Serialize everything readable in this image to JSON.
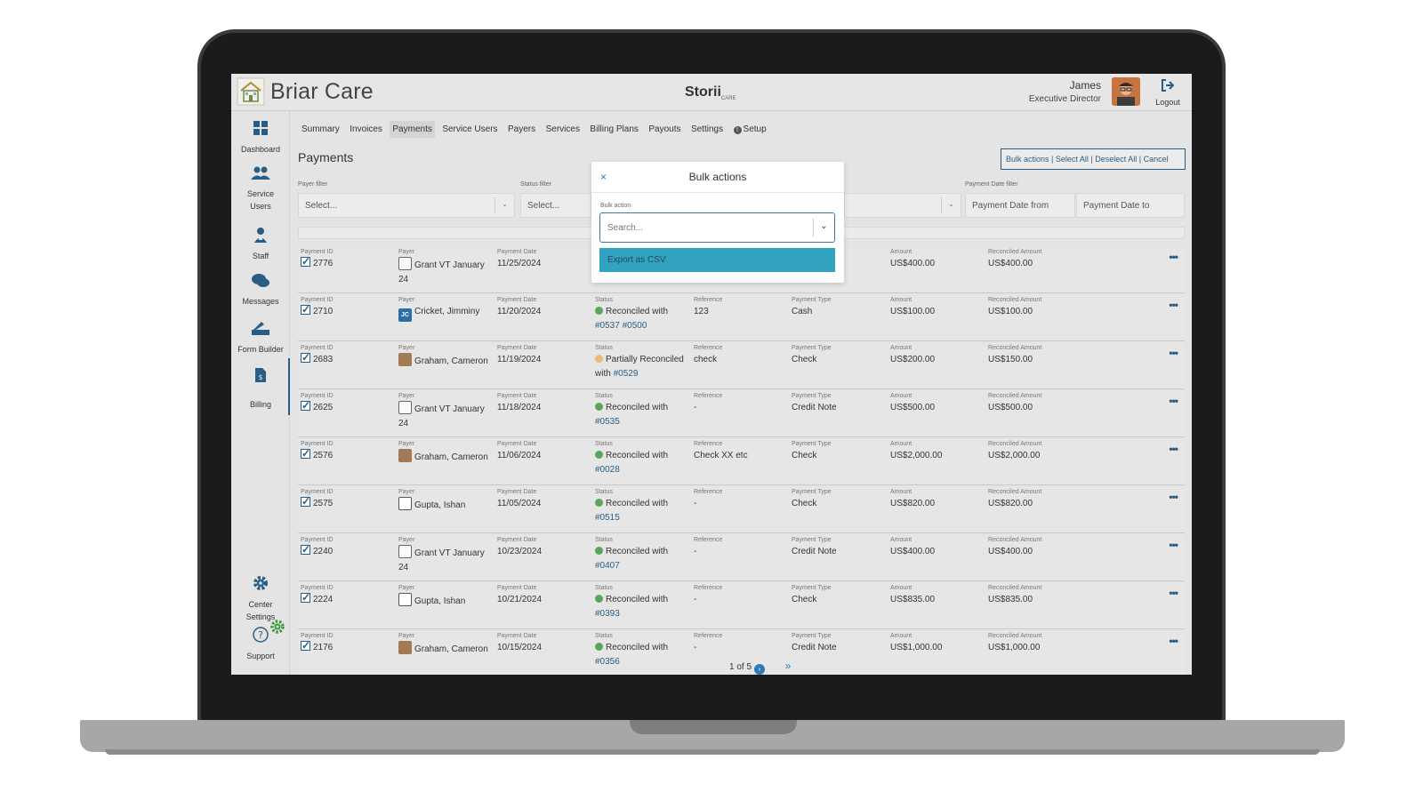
{
  "header": {
    "app_title": "Briar Care",
    "brand": "Storii",
    "brand_sub": "CARE",
    "user_name": "James",
    "user_role": "Executive Director",
    "logout_label": "Logout"
  },
  "sidebar": {
    "items": [
      {
        "label": "Dashboard",
        "icon": "dashboard-icon"
      },
      {
        "label": "Service\nUsers",
        "icon": "users-icon"
      },
      {
        "label": "Staff",
        "icon": "staff-icon"
      },
      {
        "label": "Messages",
        "icon": "messages-icon"
      },
      {
        "label": "Form Builder",
        "icon": "form-builder-icon"
      },
      {
        "label": "Billing",
        "icon": "billing-icon"
      }
    ],
    "bottom": [
      {
        "label": "Center\nSettings",
        "icon": "gear-icon"
      },
      {
        "label": "Support",
        "icon": "help-icon"
      }
    ]
  },
  "tabs": [
    "Summary",
    "Invoices",
    "Payments",
    "Service Users",
    "Payers",
    "Services",
    "Billing Plans",
    "Payouts",
    "Settings",
    "Setup"
  ],
  "page": {
    "title": "Payments",
    "bulk_bar": "Bulk actions | Select All | Deselect All | Cancel"
  },
  "filters": {
    "payer_label": "Payer filter",
    "payer_placeholder": "Select...",
    "status_label": "Status filter",
    "status_placeholder": "Select...",
    "date_label": "Payment Date filter",
    "date_from": "Payment Date from",
    "date_to": "Payment Date to"
  },
  "columns": {
    "id": "Payment ID",
    "payer": "Payer",
    "date": "Payment Date",
    "status": "Status",
    "reference": "Reference",
    "type": "Payment Type",
    "amount": "Amount",
    "reconciled": "Reconciled Amount"
  },
  "rows": [
    {
      "id": "2776",
      "payer": "Grant VT January 24",
      "payer_icon": "doc",
      "date": "11/25/2024",
      "status": "",
      "status_links": "",
      "reference": "",
      "type": "",
      "amount": "US$400.00",
      "reconciled": "US$400.00"
    },
    {
      "id": "2710",
      "payer": "Cricket, Jimminy",
      "payer_icon": "jc",
      "date": "11/20/2024",
      "status": "Reconciled with",
      "status_links": "#0537 #0500",
      "reference": "123",
      "type": "Cash",
      "amount": "US$100.00",
      "reconciled": "US$100.00"
    },
    {
      "id": "2683",
      "payer": "Graham, Cameron",
      "payer_icon": "photo",
      "date": "11/19/2024",
      "status": "Partially Reconciled",
      "status_pre": "with",
      "status_links": "#0529",
      "reference": "check",
      "type": "Check",
      "amount": "US$200.00",
      "reconciled": "US$150.00"
    },
    {
      "id": "2625",
      "payer": "Grant VT January 24",
      "payer_icon": "doc",
      "date": "11/18/2024",
      "status": "Reconciled with",
      "status_links": "#0535",
      "reference": "-",
      "type": "Credit Note",
      "amount": "US$500.00",
      "reconciled": "US$500.00"
    },
    {
      "id": "2576",
      "payer": "Graham, Cameron",
      "payer_icon": "photo",
      "date": "11/06/2024",
      "status": "Reconciled with",
      "status_links": "#0028",
      "reference": "Check XX etc",
      "type": "Check",
      "amount": "US$2,000.00",
      "reconciled": "US$2,000.00"
    },
    {
      "id": "2575",
      "payer": "Gupta, Ishan",
      "payer_icon": "person",
      "date": "11/05/2024",
      "status": "Reconciled with",
      "status_links": "#0515",
      "reference": "-",
      "type": "Check",
      "amount": "US$820.00",
      "reconciled": "US$820.00"
    },
    {
      "id": "2240",
      "payer": "Grant VT January 24",
      "payer_icon": "doc",
      "date": "10/23/2024",
      "status": "Reconciled with",
      "status_links": "#0407",
      "reference": "-",
      "type": "Credit Note",
      "amount": "US$400.00",
      "reconciled": "US$400.00"
    },
    {
      "id": "2224",
      "payer": "Gupta, Ishan",
      "payer_icon": "person",
      "date": "10/21/2024",
      "status": "Reconciled with",
      "status_links": "#0393",
      "reference": "-",
      "type": "Check",
      "amount": "US$835.00",
      "reconciled": "US$835.00"
    },
    {
      "id": "2176",
      "payer": "Graham, Cameron",
      "payer_icon": "photo",
      "date": "10/15/2024",
      "status": "Reconciled with",
      "status_links": "#0356",
      "reference": "-",
      "type": "Credit Note",
      "amount": "US$1,000.00",
      "reconciled": "US$1,000.00"
    }
  ],
  "pager": {
    "text": "1 of 5"
  },
  "modal": {
    "close": "×",
    "title": "Bulk actions",
    "field_label": "Bulk action",
    "search_placeholder": "Search...",
    "option": "Export as CSV"
  },
  "colors": {
    "accent": "#2a5d84",
    "highlight": "#31a3c0",
    "success": "#5aa55e",
    "warning": "#e9b97a"
  }
}
